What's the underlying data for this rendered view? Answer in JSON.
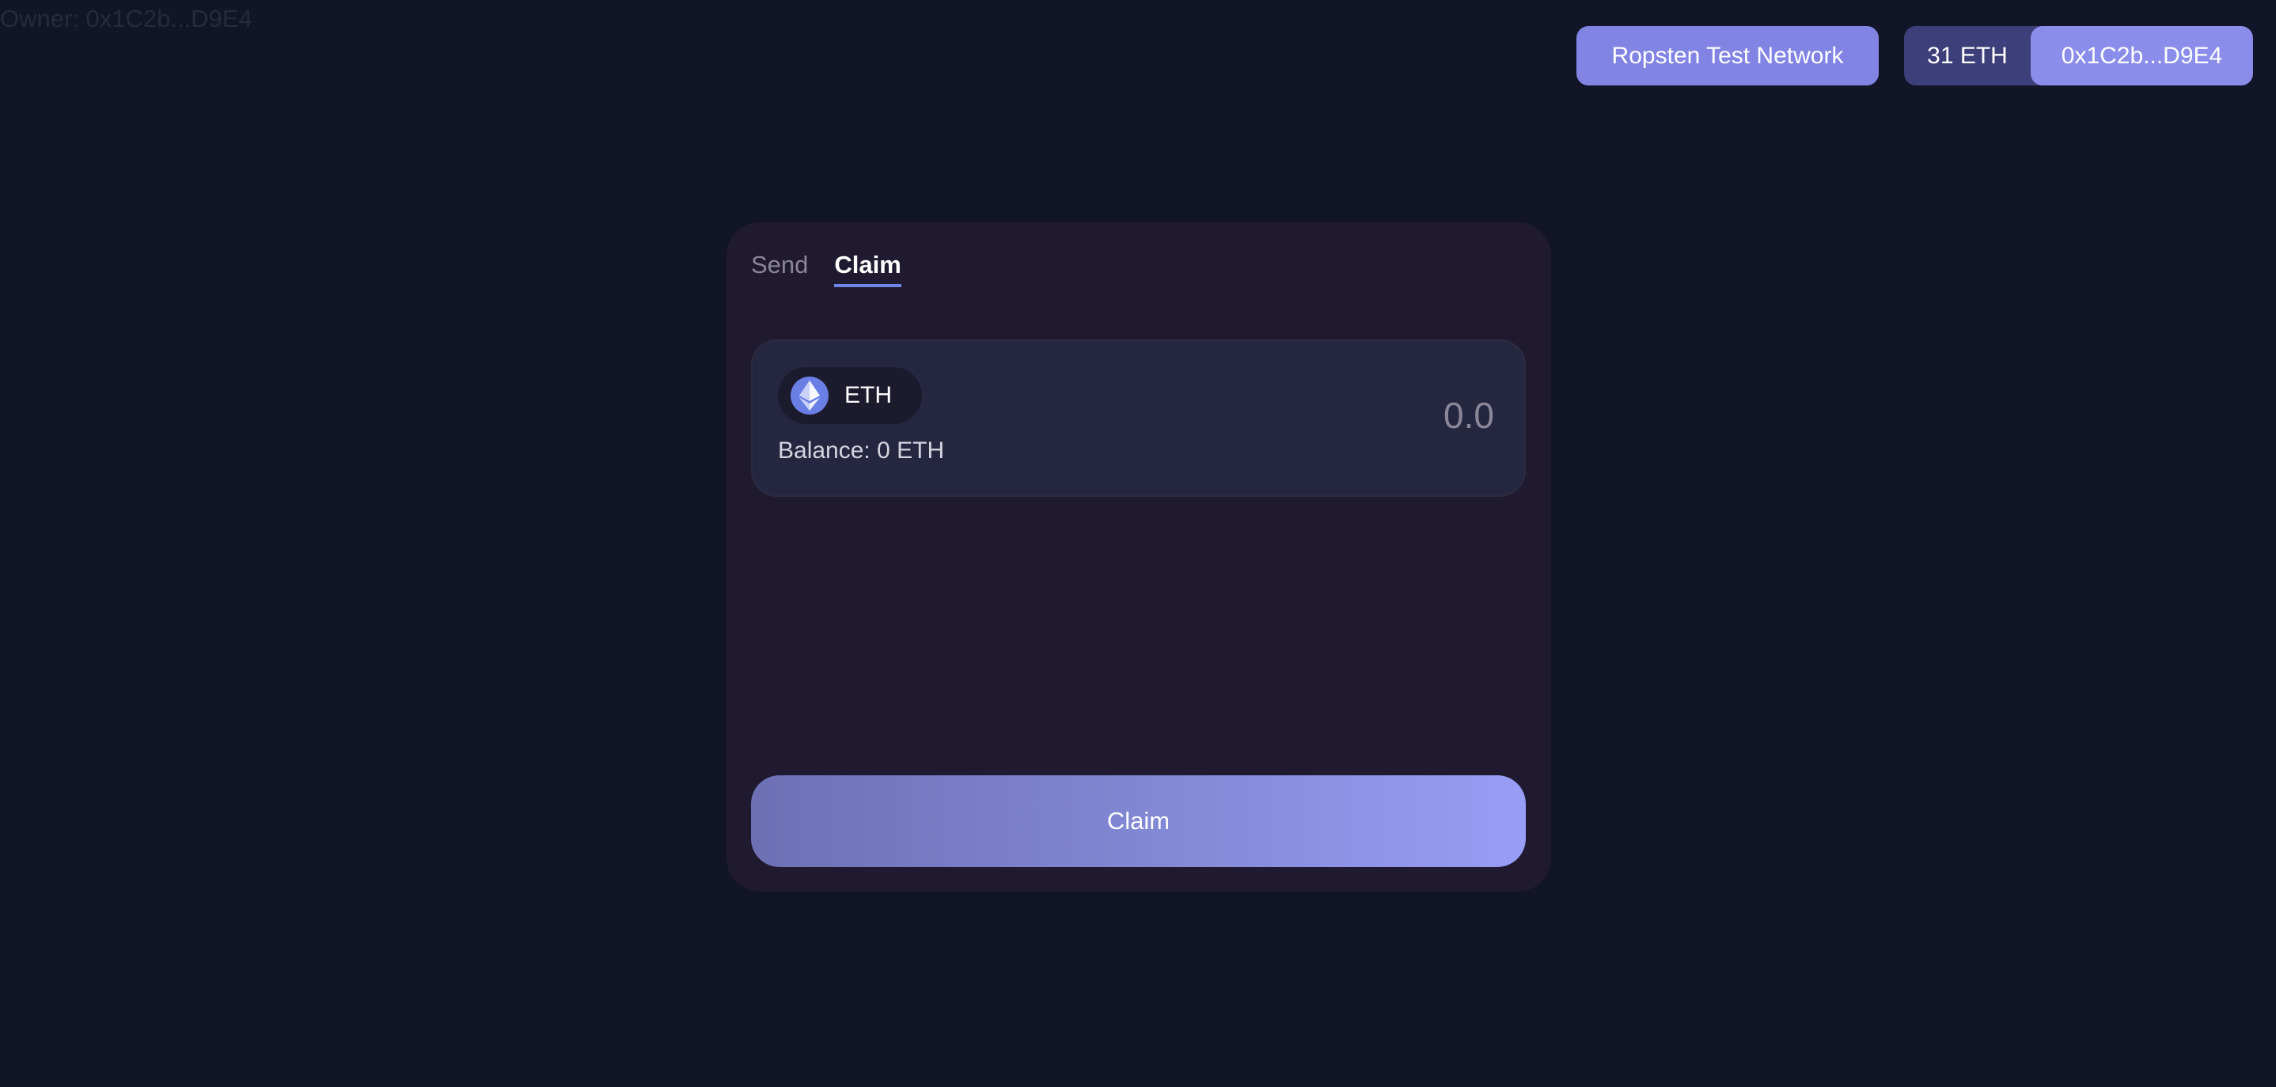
{
  "owner": {
    "label": "Owner: 0x1C2b...D9E4"
  },
  "header": {
    "network_label": "Ropsten Test Network",
    "balance_label": "31 ETH",
    "address_label": "0x1C2b...D9E4"
  },
  "tabs": [
    {
      "label": "Send",
      "active": false
    },
    {
      "label": "Claim",
      "active": true
    }
  ],
  "token_panel": {
    "token_symbol": "ETH",
    "token_icon": "ethereum-icon",
    "balance_text": "Balance: 0 ETH",
    "amount_placeholder": "0.0"
  },
  "actions": {
    "claim_label": "Claim"
  },
  "colors": {
    "background": "#111527",
    "card": "#201a30",
    "accent": "#8184e3",
    "tab_underline": "#6e86e8"
  }
}
